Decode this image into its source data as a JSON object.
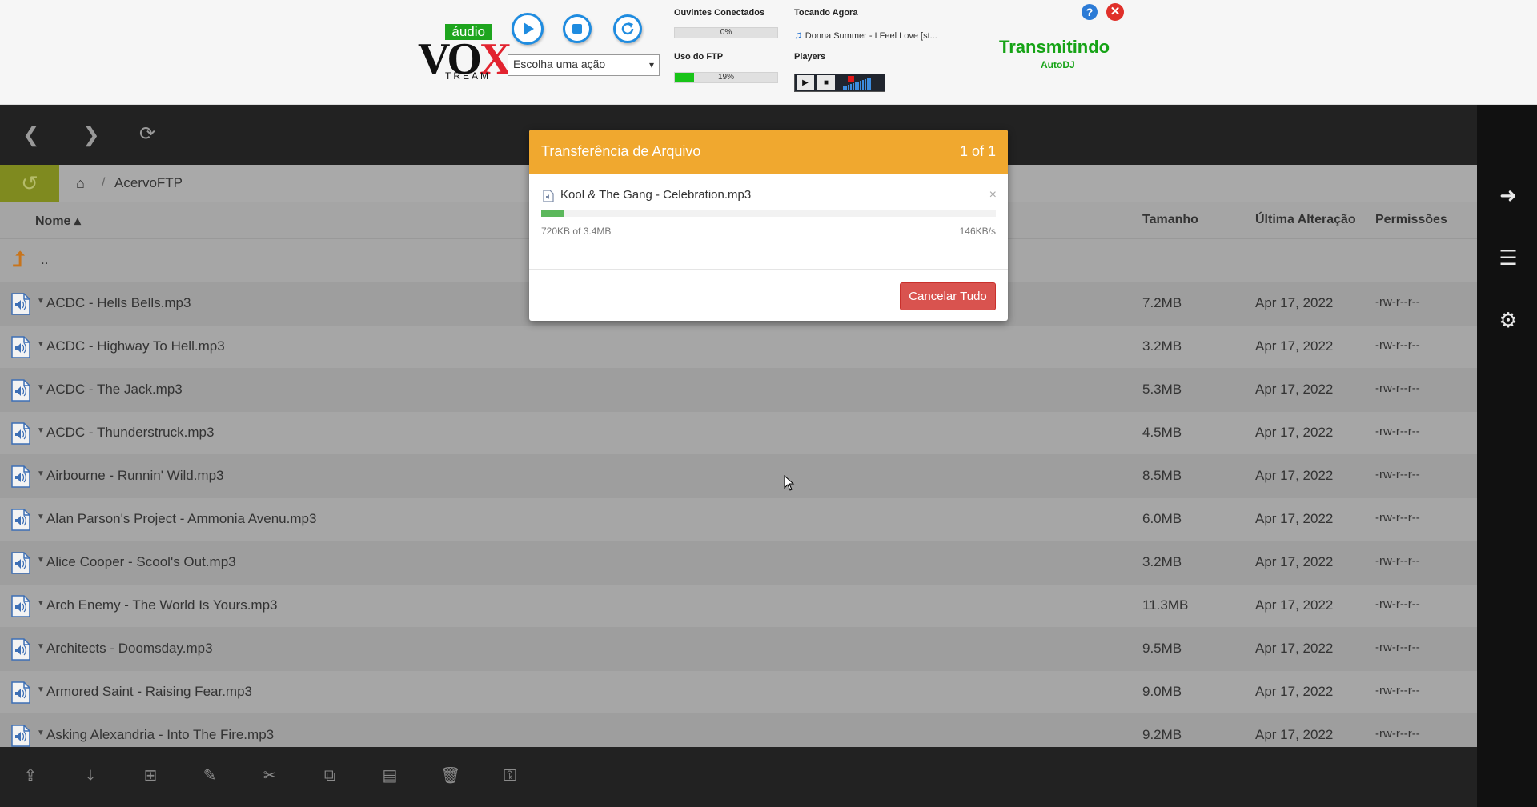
{
  "top": {
    "logo": {
      "badge": "áudio",
      "vox_v": "V",
      "vox_o": "O",
      "vox_x": "X",
      "tream": "TREAM"
    },
    "controls": {
      "play_icon": "play-icon",
      "stop_icon": "stop-icon",
      "restart_icon": "restart-icon"
    },
    "action_select": {
      "value": "Escolha uma ação",
      "options": [
        "Escolha uma ação"
      ]
    },
    "listeners": {
      "label": "Ouvintes Conectados",
      "percent": 0,
      "text": "0%"
    },
    "ftp": {
      "label": "Uso do FTP",
      "percent": 19,
      "text": "19%"
    },
    "now_playing": {
      "label": "Tocando Agora",
      "track": "Donna Summer - I Feel Love [st..."
    },
    "players": {
      "label": "Players"
    },
    "status": {
      "main": "Transmitindo",
      "sub": "AutoDJ"
    },
    "colors": {
      "accent_blue": "#1f8ce0",
      "status_green": "#16a316",
      "ftp_fill": "#18c418",
      "close_red": "#e0302a"
    }
  },
  "navbar": {
    "back_icon": "chevron-left-icon",
    "forward_icon": "chevron-right-icon",
    "refresh_icon": "refresh-icon",
    "menu_icon": "hamburger-icon"
  },
  "breadcrumb": {
    "folder": "AcervoFTP"
  },
  "columns": {
    "name": "Nome ▴",
    "size": "Tamanho",
    "modified": "Última Alteração",
    "permissions": "Permissões"
  },
  "parent_dir": "..",
  "files": [
    {
      "name": "ACDC - Hells Bells.mp3",
      "size": "7.2MB",
      "date": "Apr 17, 2022",
      "perm": "-rw-r--r--"
    },
    {
      "name": "ACDC - Highway To Hell.mp3",
      "size": "3.2MB",
      "date": "Apr 17, 2022",
      "perm": "-rw-r--r--"
    },
    {
      "name": "ACDC - The Jack.mp3",
      "size": "5.3MB",
      "date": "Apr 17, 2022",
      "perm": "-rw-r--r--"
    },
    {
      "name": "ACDC - Thunderstruck.mp3",
      "size": "4.5MB",
      "date": "Apr 17, 2022",
      "perm": "-rw-r--r--"
    },
    {
      "name": "Airbourne - Runnin' Wild.mp3",
      "size": "8.5MB",
      "date": "Apr 17, 2022",
      "perm": "-rw-r--r--"
    },
    {
      "name": "Alan Parson's Project - Ammonia Avenu.mp3",
      "size": "6.0MB",
      "date": "Apr 17, 2022",
      "perm": "-rw-r--r--"
    },
    {
      "name": "Alice Cooper - Scool's Out.mp3",
      "size": "3.2MB",
      "date": "Apr 17, 2022",
      "perm": "-rw-r--r--"
    },
    {
      "name": "Arch Enemy - The World Is Yours.mp3",
      "size": "11.3MB",
      "date": "Apr 17, 2022",
      "perm": "-rw-r--r--"
    },
    {
      "name": "Architects - Doomsday.mp3",
      "size": "9.5MB",
      "date": "Apr 17, 2022",
      "perm": "-rw-r--r--"
    },
    {
      "name": "Armored Saint - Raising Fear.mp3",
      "size": "9.0MB",
      "date": "Apr 17, 2022",
      "perm": "-rw-r--r--"
    },
    {
      "name": "Asking Alexandria - Into The Fire.mp3",
      "size": "9.2MB",
      "date": "Apr 17, 2022",
      "perm": "-rw-r--r--"
    }
  ],
  "toolbar_icons": [
    "upload-icon",
    "download-icon",
    "new-folder-icon",
    "rename-icon",
    "cut-icon",
    "copy-icon",
    "paste-icon",
    "delete-icon",
    "permissions-icon"
  ],
  "sidebar_icons": [
    "login-icon",
    "server-icon",
    "gear-icon"
  ],
  "modal": {
    "title": "Transferência de Arquivo",
    "count": "1 of 1",
    "file": "Kool & The Gang - Celebration.mp3",
    "close": "×",
    "progress_percent": 5.1,
    "bytes": "720KB of 3.4MB",
    "speed": "146KB/s",
    "cancel_label": "Cancelar Tudo"
  }
}
